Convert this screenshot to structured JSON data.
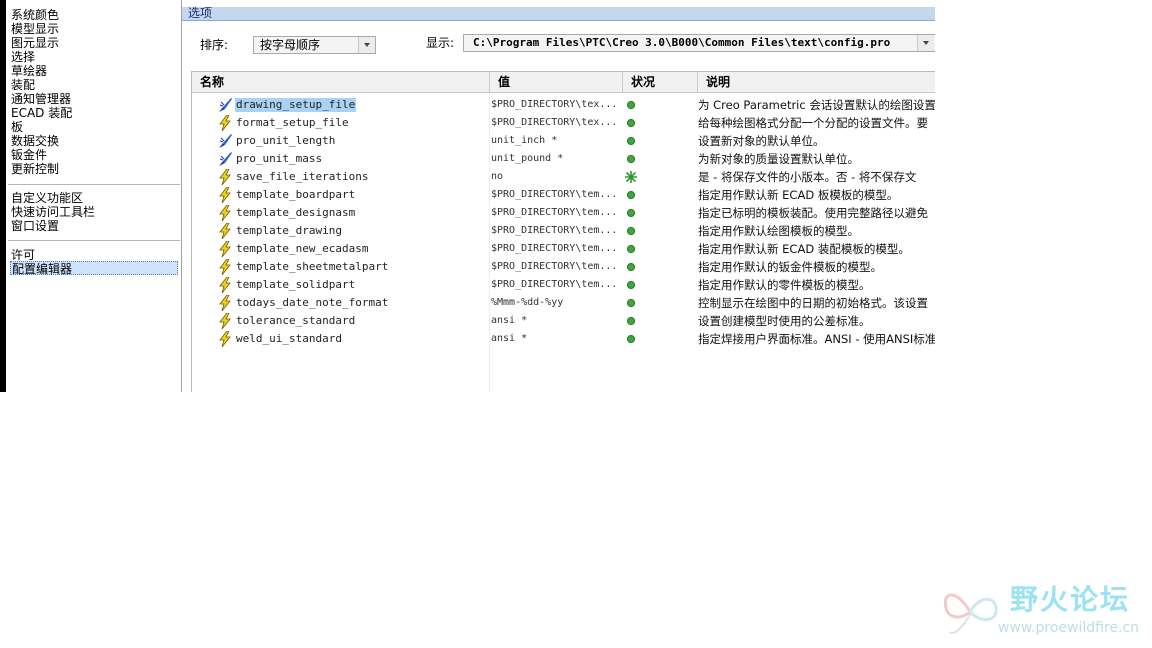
{
  "sidebar": {
    "items": [
      "系统颜色",
      "模型显示",
      "图元显示",
      "选择",
      "草绘器",
      "装配",
      "通知管理器",
      "ECAD 装配",
      "板",
      "数据交换",
      "钣金件",
      "更新控制"
    ],
    "group2": [
      "自定义功能区",
      "快速访问工具栏",
      "窗口设置"
    ],
    "group3": [
      "许可"
    ],
    "selected": "配置编辑器"
  },
  "options": {
    "title": "选项",
    "sort_label": "排序:",
    "sort_value": "按字母顺序",
    "show_label": "显示:",
    "show_value": "C:\\Program Files\\PTC\\Creo 3.0\\B000\\Common Files\\text\\config.pro"
  },
  "table": {
    "headers": {
      "name": "名称",
      "value": "值",
      "status": "状况",
      "desc": "说明"
    },
    "rows": [
      {
        "name": "drawing_setup_file",
        "value": "$PRO_DIRECTORY\\tex...",
        "icon": "brush-icon",
        "status": "dot",
        "desc": "为 Creo Parametric 会话设置默认的绘图设置",
        "selected": true
      },
      {
        "name": "format_setup_file",
        "value": "$PRO_DIRECTORY\\tex...",
        "icon": "lightning-icon",
        "status": "dot",
        "desc": "给每种绘图格式分配一个分配的设置文件。要"
      },
      {
        "name": "pro_unit_length",
        "value": "unit_inch *",
        "icon": "brush-icon",
        "status": "dot",
        "desc": "设置新对象的默认单位。"
      },
      {
        "name": "pro_unit_mass",
        "value": "unit_pound *",
        "icon": "brush-icon",
        "status": "dot",
        "desc": "为新对象的质量设置默认单位。"
      },
      {
        "name": "save_file_iterations",
        "value": "no",
        "icon": "lightning-icon",
        "status": "star",
        "desc": "是 - 将保存文件的小版本。否 - 将不保存文"
      },
      {
        "name": "template_boardpart",
        "value": "$PRO_DIRECTORY\\tem...",
        "icon": "lightning-icon",
        "status": "dot",
        "desc": "指定用作默认新 ECAD 板模板的模型。"
      },
      {
        "name": "template_designasm",
        "value": "$PRO_DIRECTORY\\tem...",
        "icon": "lightning-icon",
        "status": "dot",
        "desc": "指定已标明的模板装配。使用完整路径以避免"
      },
      {
        "name": "template_drawing",
        "value": "$PRO_DIRECTORY\\tem...",
        "icon": "lightning-icon",
        "status": "dot",
        "desc": "指定用作默认绘图模板的模型。"
      },
      {
        "name": "template_new_ecadasm",
        "value": "$PRO_DIRECTORY\\tem...",
        "icon": "lightning-icon",
        "status": "dot",
        "desc": "指定用作默认新 ECAD 装配模板的模型。"
      },
      {
        "name": "template_sheetmetalpart",
        "value": "$PRO_DIRECTORY\\tem...",
        "icon": "lightning-icon",
        "status": "dot",
        "desc": "指定用作默认的钣金件模板的模型。"
      },
      {
        "name": "template_solidpart",
        "value": "$PRO_DIRECTORY\\tem...",
        "icon": "lightning-icon",
        "status": "dot",
        "desc": "指定用作默认的零件模板的模型。"
      },
      {
        "name": "todays_date_note_format",
        "value": "%Mmm-%dd-%yy",
        "icon": "lightning-icon",
        "status": "dot",
        "desc": "控制显示在绘图中的日期的初始格式。该设置"
      },
      {
        "name": "tolerance_standard",
        "value": "ansi *",
        "icon": "lightning-icon",
        "status": "dot",
        "desc": "设置创建模型时使用的公差标准。"
      },
      {
        "name": "weld_ui_standard",
        "value": "ansi *",
        "icon": "lightning-icon",
        "status": "dot",
        "desc": "指定焊接用户界面标准。ANSI - 使用ANSI标准"
      }
    ]
  },
  "watermark": {
    "text": "野火论坛",
    "url": "www.proewildfire.cn"
  }
}
